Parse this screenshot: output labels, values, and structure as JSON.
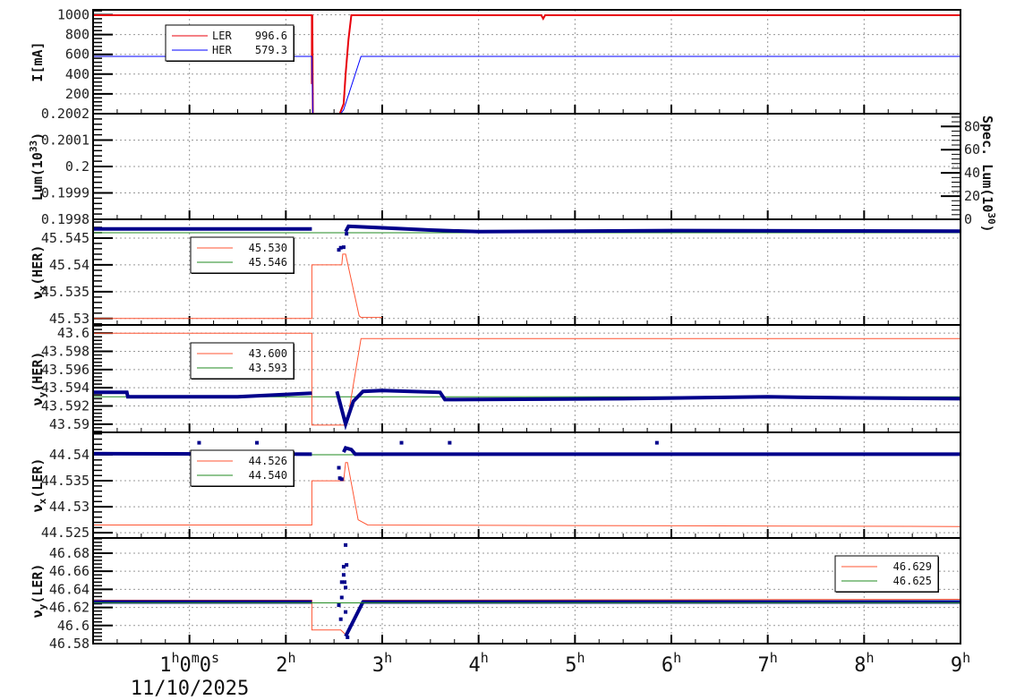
{
  "x_axis": {
    "range_hours": [
      0,
      9
    ],
    "ticks": [
      {
        "h": 1,
        "label": "1",
        "sup": "h",
        "extra": [
          [
            "0",
            "m"
          ],
          [
            "0",
            "s"
          ]
        ]
      },
      {
        "h": 2,
        "label": "2",
        "sup": "h"
      },
      {
        "h": 3,
        "label": "3",
        "sup": "h"
      },
      {
        "h": 4,
        "label": "4",
        "sup": "h"
      },
      {
        "h": 5,
        "label": "5",
        "sup": "h"
      },
      {
        "h": 6,
        "label": "6",
        "sup": "h"
      },
      {
        "h": 7,
        "label": "7",
        "sup": "h"
      },
      {
        "h": 8,
        "label": "8",
        "sup": "h"
      },
      {
        "h": 9,
        "label": "9",
        "sup": "h"
      }
    ],
    "date": "11/10/2025"
  },
  "colors": {
    "ler": "#e8000b",
    "her": "#0000ff",
    "set": "#ff5533",
    "ref": "#228b22",
    "meas": "#00008b"
  },
  "chart_data": [
    {
      "type": "line",
      "name": "current",
      "ylabel": {
        "main": "I[mA]",
        "sub": "",
        "sup": "",
        "tail": ""
      },
      "ylim": [
        0,
        1050
      ],
      "yticks": [
        [
          200,
          "200"
        ],
        [
          400,
          "400"
        ],
        [
          600,
          "600"
        ],
        [
          800,
          "800"
        ],
        [
          1000,
          "1000"
        ]
      ],
      "legend": {
        "pos": "top-left",
        "entries": [
          {
            "label": "LER",
            "value": "996.6",
            "color": "#e8000b"
          },
          {
            "label": "HER",
            "value": "579.3",
            "color": "#0000ff"
          }
        ]
      },
      "series": [
        {
          "name": "LER",
          "color": "#e8000b",
          "width": 2,
          "points": [
            [
              0,
              996
            ],
            [
              2.27,
              996
            ],
            [
              2.27,
              300
            ],
            [
              2.275,
              996
            ],
            [
              2.28,
              0
            ],
            [
              2.56,
              0
            ],
            [
              2.6,
              100
            ],
            [
              2.62,
              400
            ],
            [
              2.65,
              750
            ],
            [
              2.68,
              996
            ],
            [
              4.65,
              996
            ],
            [
              4.67,
              960
            ],
            [
              4.69,
              996
            ],
            [
              9,
              996
            ]
          ]
        },
        {
          "name": "HER",
          "color": "#0000ff",
          "width": 1,
          "points": [
            [
              0,
              579
            ],
            [
              2.27,
              579
            ],
            [
              2.28,
              0
            ],
            [
              2.57,
              0
            ],
            [
              2.6,
              40
            ],
            [
              2.78,
              579
            ],
            [
              9,
              579
            ]
          ]
        }
      ]
    },
    {
      "type": "line",
      "name": "luminosity",
      "ylabel": {
        "main": "Lum(10",
        "sub": "",
        "sup": "33",
        "tail": ")"
      },
      "ylim": [
        0.1998,
        0.2002
      ],
      "yticks": [
        [
          0.1998,
          "0.1998"
        ],
        [
          0.1999,
          "0.1999"
        ],
        [
          0.2,
          "0.2"
        ],
        [
          0.2001,
          "0.2001"
        ],
        [
          0.2002,
          "0.2002"
        ]
      ],
      "right_axis": {
        "label_main": "Spec. Lum(10",
        "label_sup": "30",
        "label_tail": ")",
        "ylim": [
          0,
          91
        ],
        "yticks": [
          [
            0,
            "0"
          ],
          [
            20,
            "20"
          ],
          [
            40,
            "40"
          ],
          [
            60,
            "60"
          ],
          [
            80,
            "80"
          ]
        ]
      },
      "series": []
    },
    {
      "type": "line",
      "name": "tune-x-her",
      "ylabel": {
        "main": "ν",
        "sub": "x",
        "sup": "",
        "tail": "(HER)"
      },
      "ylim": [
        45.5288,
        45.5485
      ],
      "yticks": [
        [
          45.53,
          "45.53"
        ],
        [
          45.535,
          "45.535"
        ],
        [
          45.54,
          "45.54"
        ],
        [
          45.545,
          "45.545"
        ]
      ],
      "legend": {
        "pos": "top-left",
        "entries": [
          {
            "label": "",
            "value": "45.530",
            "color": "#ff5533"
          },
          {
            "label": "",
            "value": "45.546",
            "color": "#228b22"
          }
        ]
      },
      "series": [
        {
          "name": "reference",
          "color": "#228b22",
          "width": 1,
          "points": [
            [
              0,
              45.546
            ],
            [
              9,
              45.546
            ]
          ]
        },
        {
          "name": "set",
          "color": "#ff5533",
          "width": 1,
          "points": [
            [
              0,
              45.53
            ],
            [
              2.27,
              45.53
            ],
            [
              2.27,
              45.54
            ],
            [
              2.58,
              45.54
            ],
            [
              2.59,
              45.542
            ],
            [
              2.62,
              45.542
            ],
            [
              2.76,
              45.5305
            ],
            [
              2.78,
              45.5302
            ],
            [
              3.0,
              45.5302
            ]
          ]
        },
        {
          "name": "measured",
          "color": "#00008b",
          "width": 4,
          "points": [
            [
              0,
              45.5467
            ],
            [
              2.27,
              45.5467
            ]
          ]
        },
        {
          "name": "measured2",
          "color": "#00008b",
          "width": 4,
          "points": [
            [
              2.62,
              45.5462
            ],
            [
              2.65,
              45.5472
            ],
            [
              2.9,
              45.547
            ],
            [
              3.5,
              45.5465
            ],
            [
              4,
              45.5462
            ],
            [
              6,
              45.5464
            ],
            [
              9,
              45.5463
            ]
          ]
        },
        {
          "name": "outliers",
          "color": "#00008b",
          "kind": "points",
          "points": [
            [
              2.55,
              45.5428
            ],
            [
              2.57,
              45.5432
            ],
            [
              2.6,
              45.5433
            ],
            [
              2.63,
              45.5458
            ]
          ]
        }
      ]
    },
    {
      "type": "line",
      "name": "tune-y-her",
      "ylabel": {
        "main": "ν",
        "sub": "y",
        "sup": "",
        "tail": "(HER)"
      },
      "ylim": [
        43.5891,
        43.6009
      ],
      "yticks": [
        [
          43.59,
          "43.59"
        ],
        [
          43.592,
          "43.592"
        ],
        [
          43.594,
          "43.594"
        ],
        [
          43.596,
          "43.596"
        ],
        [
          43.598,
          "43.598"
        ],
        [
          43.6,
          "43.6"
        ]
      ],
      "legend": {
        "pos": "top-left",
        "entries": [
          {
            "label": "",
            "value": "43.600",
            "color": "#ff5533"
          },
          {
            "label": "",
            "value": "43.593",
            "color": "#228b22"
          }
        ]
      },
      "series": [
        {
          "name": "reference",
          "color": "#228b22",
          "width": 1,
          "points": [
            [
              0,
              43.593
            ],
            [
              9,
              43.593
            ]
          ]
        },
        {
          "name": "set",
          "color": "#ff5533",
          "width": 1,
          "points": [
            [
              0,
              43.6
            ],
            [
              2.27,
              43.6
            ],
            [
              2.27,
              43.5899
            ],
            [
              2.63,
              43.5899
            ],
            [
              2.78,
              43.5994
            ],
            [
              9,
              43.5994
            ]
          ]
        },
        {
          "name": "measured",
          "color": "#00008b",
          "width": 4,
          "points": [
            [
              0,
              43.5935
            ],
            [
              0.35,
              43.5935
            ],
            [
              0.36,
              43.593
            ],
            [
              1.5,
              43.593
            ],
            [
              2.27,
              43.5934
            ]
          ]
        },
        {
          "name": "measured2",
          "color": "#00008b",
          "width": 4,
          "points": [
            [
              2.53,
              43.5936
            ],
            [
              2.62,
              43.59
            ],
            [
              2.7,
              43.5925
            ],
            [
              2.8,
              43.5936
            ],
            [
              3.0,
              43.5937
            ],
            [
              3.6,
              43.5935
            ],
            [
              3.65,
              43.5927
            ],
            [
              5.5,
              43.5928
            ],
            [
              7,
              43.593
            ],
            [
              7.8,
              43.5929
            ],
            [
              9,
              43.5928
            ]
          ]
        }
      ]
    },
    {
      "type": "line",
      "name": "tune-x-ler",
      "ylabel": {
        "main": "ν",
        "sub": "x",
        "sup": "",
        "tail": "(LER)"
      },
      "ylim": [
        44.524,
        44.5443
      ],
      "yticks": [
        [
          44.525,
          "44.525"
        ],
        [
          44.53,
          "44.53"
        ],
        [
          44.535,
          "44.535"
        ],
        [
          44.54,
          "44.54"
        ]
      ],
      "legend": {
        "pos": "top-left",
        "entries": [
          {
            "label": "",
            "value": "44.526",
            "color": "#ff5533"
          },
          {
            "label": "",
            "value": "44.540",
            "color": "#228b22"
          }
        ]
      },
      "series": [
        {
          "name": "reference",
          "color": "#228b22",
          "width": 1,
          "points": [
            [
              0,
              44.54
            ],
            [
              9,
              44.54
            ]
          ]
        },
        {
          "name": "set",
          "color": "#ff5533",
          "width": 1,
          "points": [
            [
              0,
              44.5265
            ],
            [
              2.27,
              44.5265
            ],
            [
              2.27,
              44.535
            ],
            [
              2.6,
              44.535
            ],
            [
              2.62,
              44.5385
            ],
            [
              2.64,
              44.5385
            ],
            [
              2.75,
              44.5275
            ],
            [
              2.85,
              44.5265
            ],
            [
              9,
              44.5262
            ]
          ]
        },
        {
          "name": "measured",
          "color": "#00008b",
          "width": 4,
          "points": [
            [
              0,
              44.5402
            ],
            [
              2.27,
              44.5401
            ]
          ]
        },
        {
          "name": "measured2",
          "color": "#00008b",
          "width": 4,
          "points": [
            [
              2.6,
              44.5405
            ],
            [
              2.62,
              44.5413
            ],
            [
              2.68,
              44.541
            ],
            [
              2.72,
              44.5401
            ],
            [
              9,
              44.5401
            ]
          ]
        },
        {
          "name": "outliers",
          "color": "#00008b",
          "kind": "points",
          "points": [
            [
              1.1,
              44.5423
            ],
            [
              1.7,
              44.5423
            ],
            [
              3.2,
              44.5423
            ],
            [
              3.7,
              44.5423
            ],
            [
              5.85,
              44.5423
            ],
            [
              2.55,
              44.5375
            ],
            [
              2.56,
              44.5355
            ],
            [
              2.58,
              44.5353
            ]
          ]
        }
      ]
    },
    {
      "type": "line",
      "name": "tune-y-ler",
      "ylabel": {
        "main": "ν",
        "sub": "y",
        "sup": "",
        "tail": "(LER)"
      },
      "ylim": [
        46.58,
        46.6968
      ],
      "yticks": [
        [
          46.58,
          "46.58"
        ],
        [
          46.6,
          "46.6"
        ],
        [
          46.62,
          "46.62"
        ],
        [
          46.64,
          "46.64"
        ],
        [
          46.66,
          "46.66"
        ],
        [
          46.68,
          "46.68"
        ]
      ],
      "legend": {
        "pos": "top-right",
        "entries": [
          {
            "label": "",
            "value": "46.629",
            "color": "#ff5533"
          },
          {
            "label": "",
            "value": "46.625",
            "color": "#228b22"
          }
        ]
      },
      "series": [
        {
          "name": "set",
          "color": "#ff5533",
          "width": 1,
          "points": [
            [
              0,
              46.628
            ],
            [
              2.27,
              46.628
            ],
            [
              2.27,
              46.595
            ],
            [
              2.57,
              46.595
            ],
            [
              2.62,
              46.59
            ],
            [
              2.8,
              46.628
            ],
            [
              9,
              46.629
            ]
          ]
        },
        {
          "name": "measured",
          "color": "#00008b",
          "width": 4,
          "points": [
            [
              0,
              46.626
            ],
            [
              2.27,
              46.626
            ]
          ]
        },
        {
          "name": "measured2",
          "color": "#00008b",
          "width": 4,
          "points": [
            [
              2.62,
              46.588
            ],
            [
              2.8,
              46.626
            ],
            [
              9,
              46.626
            ]
          ]
        },
        {
          "name": "reference",
          "color": "#228b22",
          "width": 1,
          "points": [
            [
              0,
              46.625
            ],
            [
              9,
              46.625
            ]
          ]
        },
        {
          "name": "outliers",
          "color": "#00008b",
          "kind": "points",
          "points": [
            [
              2.55,
              46.6225
            ],
            [
              2.57,
              46.607
            ],
            [
              2.58,
              46.631
            ],
            [
              2.58,
              46.648
            ],
            [
              2.6,
              46.665
            ],
            [
              2.6,
              46.656
            ],
            [
              2.61,
              46.648
            ],
            [
              2.62,
              46.689
            ],
            [
              2.62,
              46.642
            ],
            [
              2.62,
              46.615
            ],
            [
              2.63,
              46.667
            ],
            [
              2.64,
              46.587
            ]
          ]
        }
      ]
    }
  ]
}
